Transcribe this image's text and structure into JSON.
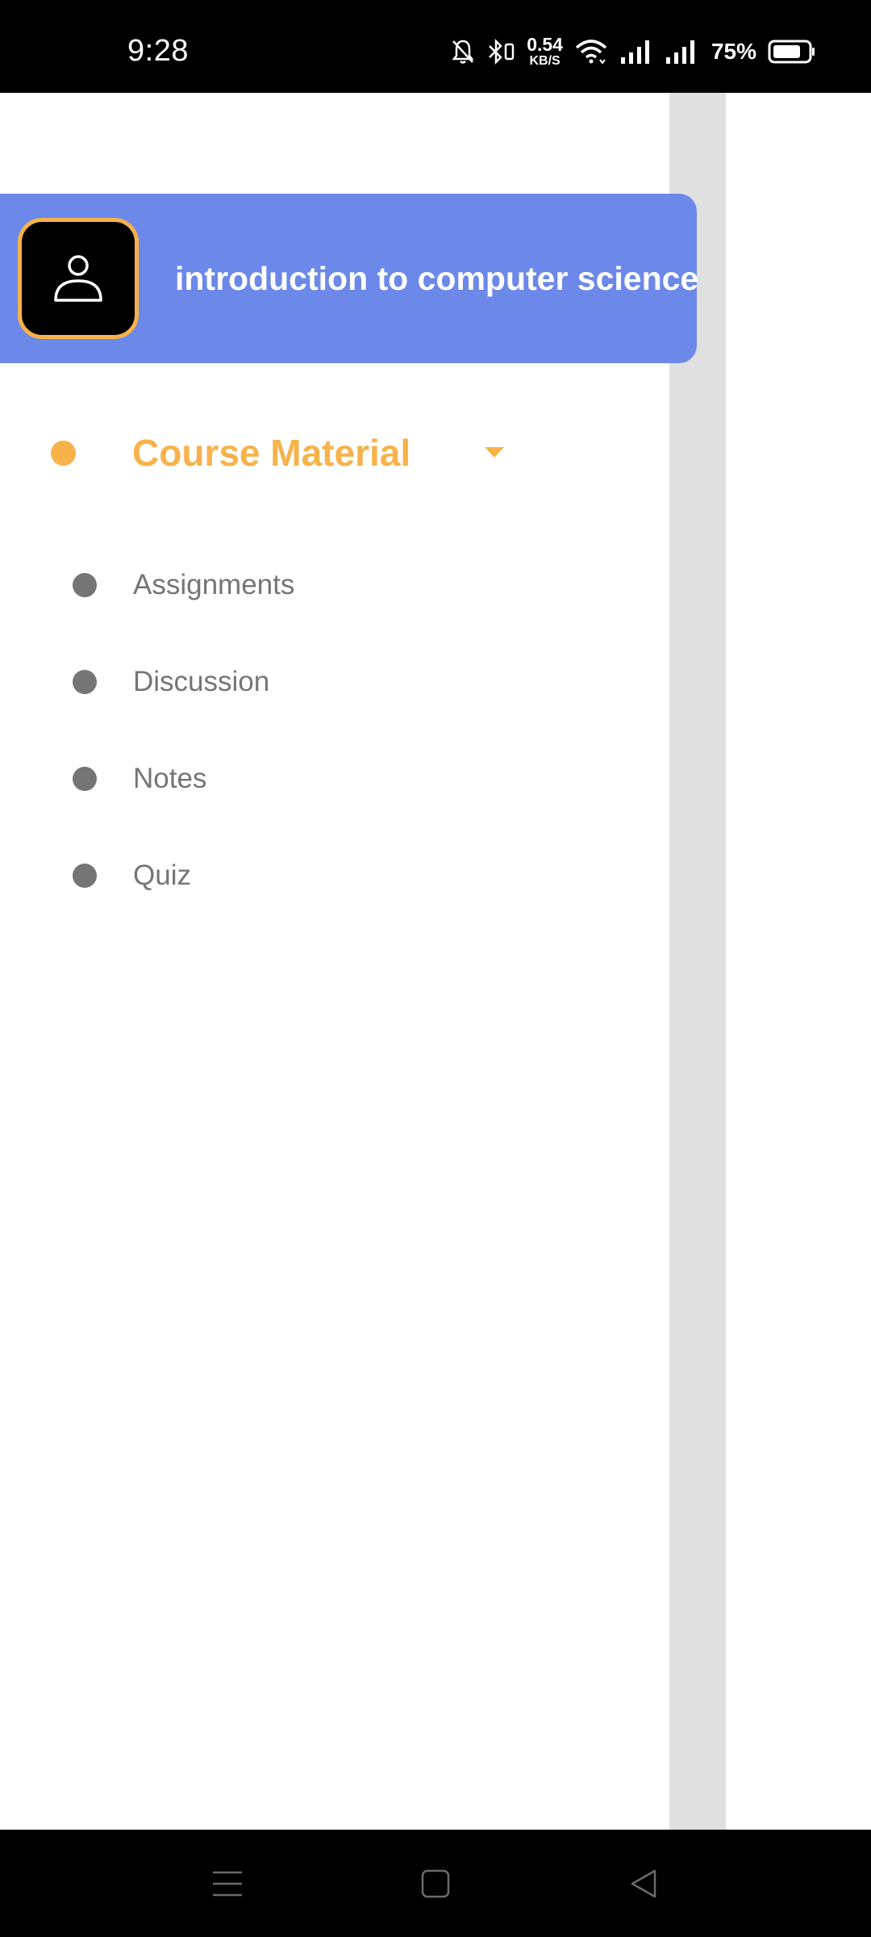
{
  "status_bar": {
    "time": "9:28",
    "net_speed_value": "0.54",
    "net_speed_unit": "KB/S",
    "battery": "75%",
    "icons": [
      "mute-bell-icon",
      "bluetooth-icon",
      "wifi-icon",
      "signal-icon",
      "signal-icon",
      "battery-icon"
    ]
  },
  "drawer": {
    "header": {
      "avatar_icon": "person-icon",
      "title": "introduction to computer science"
    },
    "section": {
      "label": "Course Material",
      "expanded": true,
      "items": [
        {
          "label": "Assignments"
        },
        {
          "label": "Discussion"
        },
        {
          "label": "Notes"
        },
        {
          "label": "Quiz"
        }
      ]
    }
  },
  "nav_bar": {
    "buttons": [
      "menu-icon",
      "home-icon",
      "back-icon"
    ]
  },
  "colors": {
    "header_bg": "#6c88e8",
    "accent": "#f7b24a",
    "menu_text": "#757575",
    "scrim_strip": "#e0e0e0"
  }
}
